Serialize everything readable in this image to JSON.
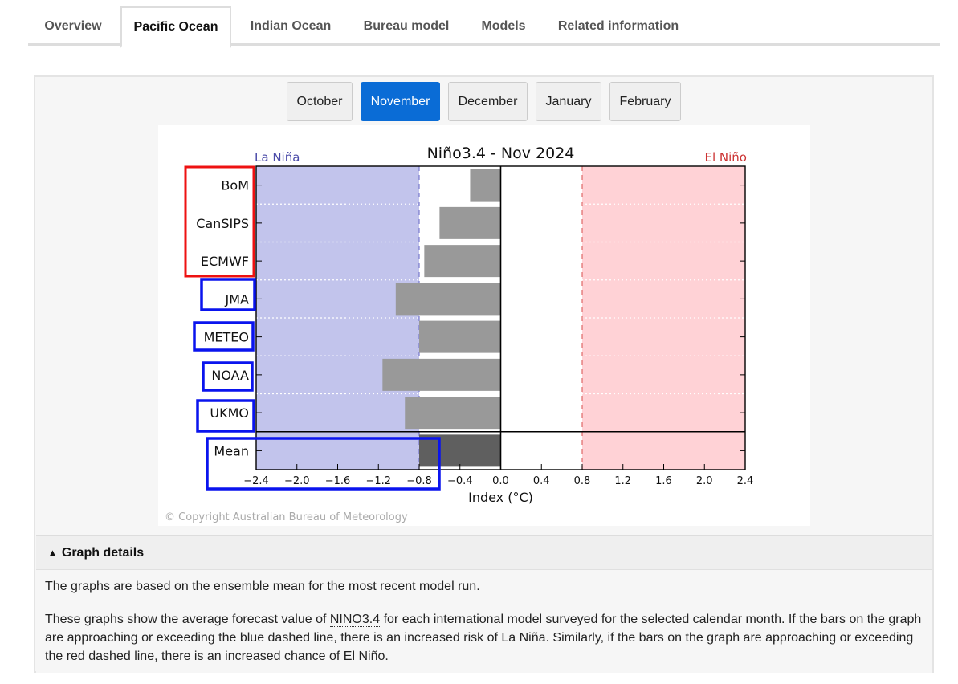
{
  "tabs": [
    {
      "label": "Overview"
    },
    {
      "label": "Pacific Ocean"
    },
    {
      "label": "Indian Ocean"
    },
    {
      "label": "Bureau model"
    },
    {
      "label": "Models"
    },
    {
      "label": "Related information"
    }
  ],
  "active_tab": "Pacific Ocean",
  "months": [
    {
      "label": "October"
    },
    {
      "label": "November"
    },
    {
      "label": "December"
    },
    {
      "label": "January"
    },
    {
      "label": "February"
    }
  ],
  "active_month": "November",
  "colors": {
    "la_nina_fill": "#c2c4ec",
    "el_nino_fill": "#ffd2d6",
    "la_nina_text": "#4a4aa8",
    "el_nino_text": "#cc3333",
    "bar": "#999999",
    "mean_bar": "#5f5f5f",
    "highlight_red": "#ee1111",
    "highlight_blue": "#0a14ee",
    "active_month_bg": "#0a6cd6"
  },
  "chart_data": {
    "type": "bar",
    "orientation": "horizontal",
    "title": "Niño3.4 - Nov 2024",
    "left_label": "La Niña",
    "right_label": "El Niño",
    "xlabel": "Index (°C)",
    "xlim": [
      -2.4,
      2.4
    ],
    "x_ticks": [
      "−2.4",
      "−2.0",
      "−1.6",
      "−1.2",
      "−0.8",
      "−0.4",
      "0.0",
      "0.4",
      "0.8",
      "1.2",
      "1.6",
      "2.0",
      "2.4"
    ],
    "thresholds": [
      -0.8,
      0.8
    ],
    "categories": [
      "BoM",
      "CanSIPS",
      "ECMWF",
      "JMA",
      "METEO",
      "NOAA",
      "UKMO"
    ],
    "values": [
      -0.3,
      -0.6,
      -0.75,
      -1.03,
      -0.8,
      -1.16,
      -0.94
    ],
    "mean": {
      "label": "Mean",
      "value": -0.8
    },
    "grid": "horizontal dotted",
    "copyright": "© Copyright Australian Bureau of Meteorology"
  },
  "details": {
    "heading": "Graph details",
    "p1": "The graphs are based on the ensemble mean for the most recent model run.",
    "p2_before": "These graphs show the average forecast value of ",
    "p2_abbr": "NINO3.4",
    "p2_after": " for each international model surveyed for the selected calendar month. If the bars on the graph are approaching or exceeding the blue dashed line, there is an increased risk of La Niña. Similarly, if the bars on the graph are approaching or exceeding the red dashed line, there is an increased chance of El Niño."
  }
}
